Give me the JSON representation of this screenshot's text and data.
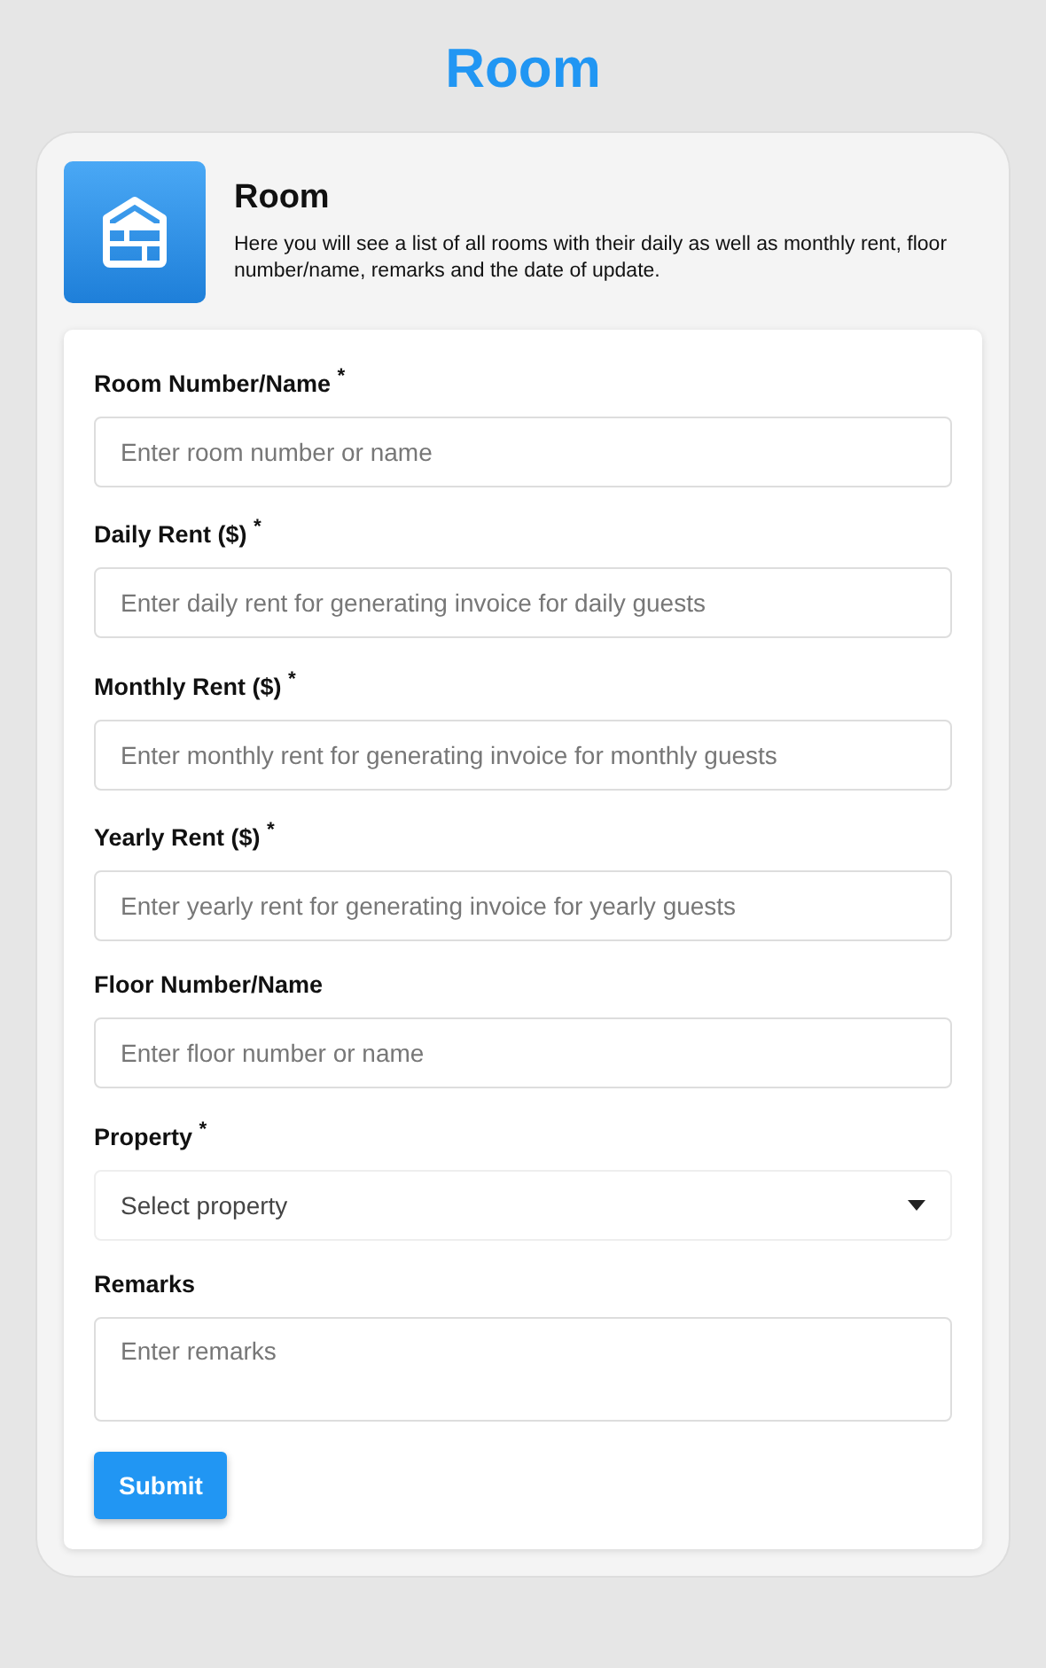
{
  "page_title": "Room",
  "header": {
    "title": "Room",
    "description": "Here you will see a list of all rooms with their daily as well as monthly rent, floor number/name, remarks and the date of update."
  },
  "fields": [
    {
      "kind": "text",
      "label": "Room Number/Name $^{*}$",
      "placeholder": "Enter room number or name"
    },
    {
      "kind": "text",
      "label": "Daily Rent ($) $^{*}$",
      "placeholder": "Enter daily rent for generating invoice for daily guests"
    },
    {
      "kind": "text",
      "label": "Monthly Rent ($) $^{*}$",
      "placeholder": "Enter monthly rent for generating invoice for monthly guests"
    },
    {
      "kind": "text",
      "label": "Yearly Rent ($) $^{*}$",
      "placeholder": "Enter yearly rent for generating invoice for yearly guests"
    },
    {
      "kind": "text",
      "label": "Floor Number/Name",
      "placeholder": "Enter floor number or name"
    },
    {
      "kind": "select",
      "label": "Property $^{*}$",
      "value": "Select property"
    },
    {
      "kind": "textarea",
      "label": "Remarks",
      "placeholder": "Enter remarks"
    }
  ],
  "submit": "Submit"
}
